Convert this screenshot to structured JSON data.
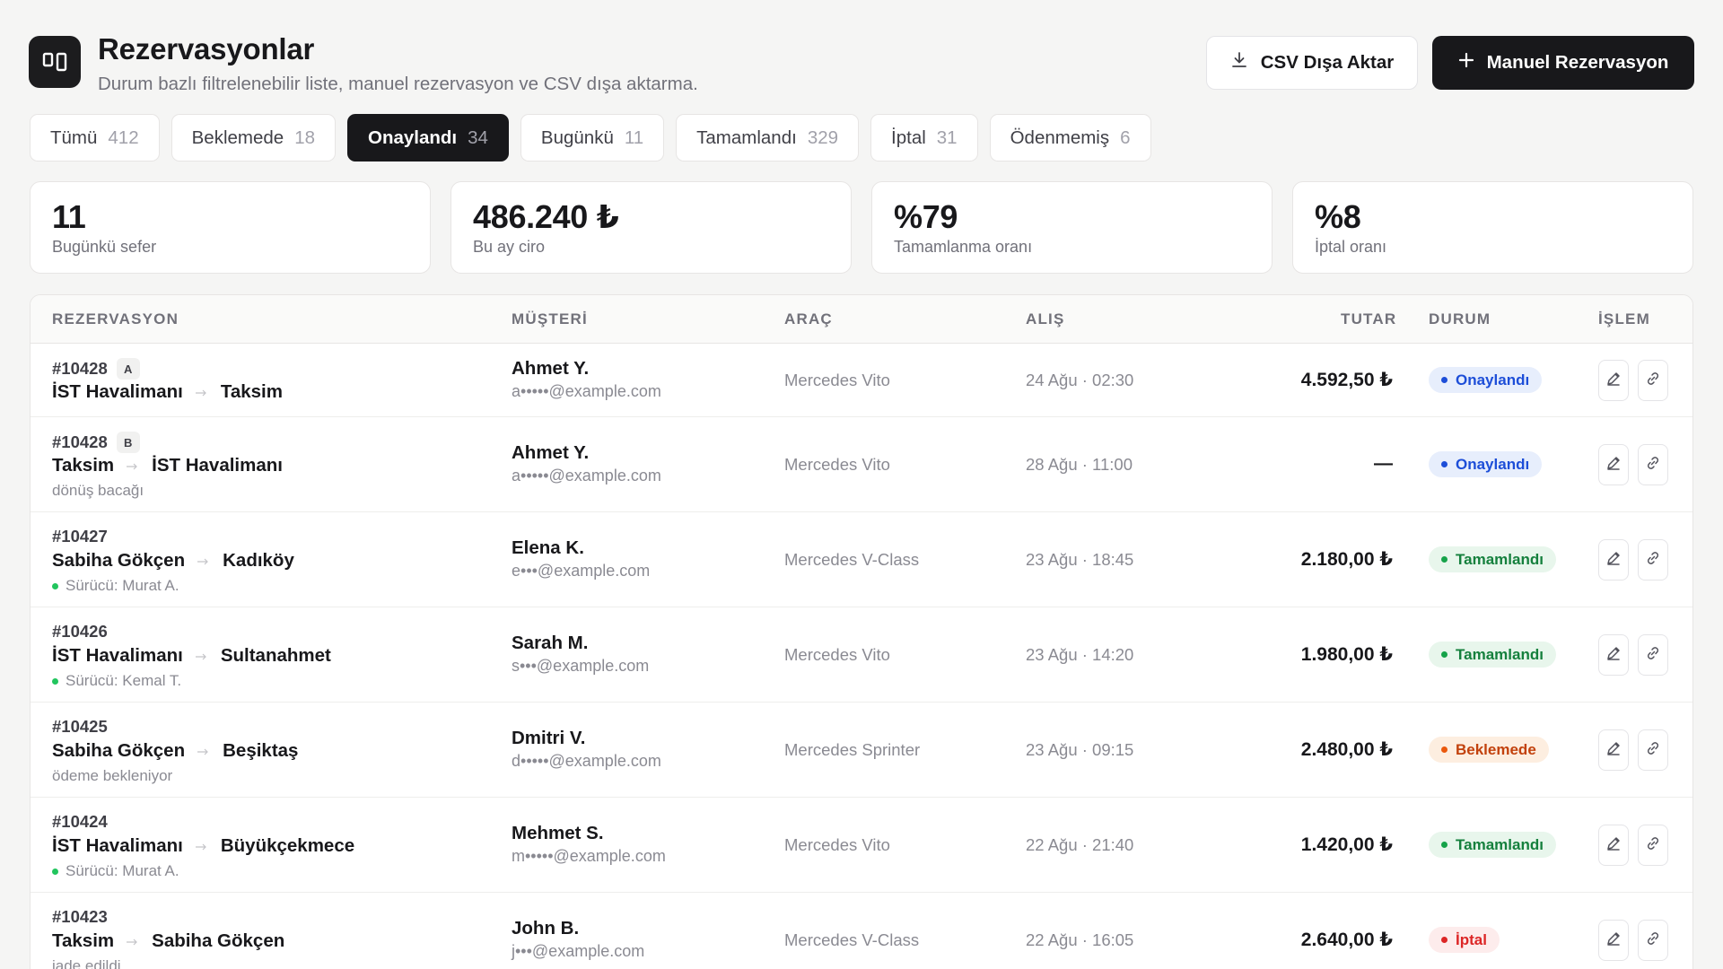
{
  "header": {
    "title": "Rezervasyonlar",
    "subtitle": "Durum bazlı filtrelenebilir liste, manuel rezervasyon ve CSV dışa aktarma.",
    "csv_label": "CSV Dışa Aktar",
    "manual_label": "Manuel Rezervasyon"
  },
  "tabs": [
    {
      "label": "Tümü",
      "count": "412",
      "active": false
    },
    {
      "label": "Beklemede",
      "count": "18",
      "active": false
    },
    {
      "label": "Onaylandı",
      "count": "34",
      "active": true
    },
    {
      "label": "Bugünkü",
      "count": "11",
      "active": false
    },
    {
      "label": "Tamamlandı",
      "count": "329",
      "active": false
    },
    {
      "label": "İptal",
      "count": "31",
      "active": false
    },
    {
      "label": "Ödenmemiş",
      "count": "6",
      "active": false
    }
  ],
  "stats": [
    {
      "value": "11",
      "label": "Bugünkü sefer"
    },
    {
      "value": "486.240 ₺",
      "label": "Bu ay ciro"
    },
    {
      "value": "%79",
      "label": "Tamamlanma oranı"
    },
    {
      "value": "%8",
      "label": "İptal oranı"
    }
  ],
  "table": {
    "columns": {
      "reservation": "REZERVASYON",
      "customer": "MÜŞTERİ",
      "vehicle": "ARAÇ",
      "pickup": "ALIŞ",
      "amount": "TUTAR",
      "status": "DURUM",
      "action": "İŞLEM"
    },
    "rows": [
      {
        "id": "#10428",
        "leg": "A",
        "from": "İST Havalimanı",
        "to": "Taksim",
        "note": "",
        "driver": false,
        "customer": "Ahmet Y.",
        "email": "a•••••@example.com",
        "vehicle": "Mercedes Vito",
        "pickup": "24 Ağu · 02:30",
        "amount": "4.592,50 ₺",
        "status": "Onaylandı",
        "status_kind": "blue"
      },
      {
        "id": "#10428",
        "leg": "B",
        "from": "Taksim",
        "to": "İST Havalimanı",
        "note": "dönüş bacağı",
        "driver": false,
        "customer": "Ahmet Y.",
        "email": "a•••••@example.com",
        "vehicle": "Mercedes Vito",
        "pickup": "28 Ağu · 11:00",
        "amount": "—",
        "status": "Onaylandı",
        "status_kind": "blue"
      },
      {
        "id": "#10427",
        "leg": "",
        "from": "Sabiha Gökçen",
        "to": "Kadıköy",
        "note": "Sürücü: Murat A.",
        "driver": true,
        "customer": "Elena K.",
        "email": "e•••@example.com",
        "vehicle": "Mercedes V-Class",
        "pickup": "23 Ağu · 18:45",
        "amount": "2.180,00 ₺",
        "status": "Tamamlandı",
        "status_kind": "green"
      },
      {
        "id": "#10426",
        "leg": "",
        "from": "İST Havalimanı",
        "to": "Sultanahmet",
        "note": "Sürücü: Kemal T.",
        "driver": true,
        "customer": "Sarah M.",
        "email": "s•••@example.com",
        "vehicle": "Mercedes Vito",
        "pickup": "23 Ağu · 14:20",
        "amount": "1.980,00 ₺",
        "status": "Tamamlandı",
        "status_kind": "green"
      },
      {
        "id": "#10425",
        "leg": "",
        "from": "Sabiha Gökçen",
        "to": "Beşiktaş",
        "note": "ödeme bekleniyor",
        "driver": false,
        "customer": "Dmitri V.",
        "email": "d•••••@example.com",
        "vehicle": "Mercedes Sprinter",
        "pickup": "23 Ağu · 09:15",
        "amount": "2.480,00 ₺",
        "status": "Beklemede",
        "status_kind": "orange"
      },
      {
        "id": "#10424",
        "leg": "",
        "from": "İST Havalimanı",
        "to": "Büyükçekmece",
        "note": "Sürücü: Murat A.",
        "driver": true,
        "customer": "Mehmet S.",
        "email": "m•••••@example.com",
        "vehicle": "Mercedes Vito",
        "pickup": "22 Ağu · 21:40",
        "amount": "1.420,00 ₺",
        "status": "Tamamlandı",
        "status_kind": "green"
      },
      {
        "id": "#10423",
        "leg": "",
        "from": "Taksim",
        "to": "Sabiha Gökçen",
        "note": "iade edildi",
        "driver": false,
        "customer": "John B.",
        "email": "j•••@example.com",
        "vehicle": "Mercedes V-Class",
        "pickup": "22 Ağu · 16:05",
        "amount": "2.640,00 ₺",
        "status": "İptal",
        "status_kind": "red"
      }
    ]
  },
  "icons": {
    "logo": "columns-icon",
    "csv": "download-icon",
    "manual": "plus-icon",
    "edit": "pencil-icon",
    "link": "link-icon",
    "route_arrow": "arrow-right-icon"
  }
}
